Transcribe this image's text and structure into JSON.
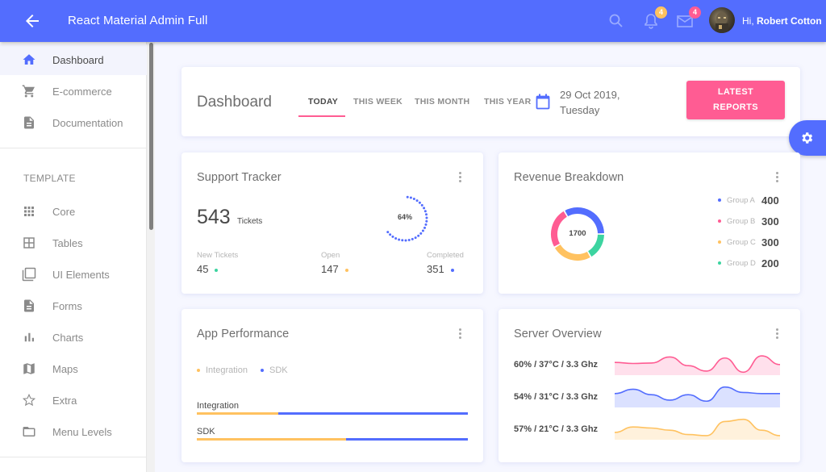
{
  "header": {
    "title": "React Material Admin Full",
    "back_icon": "arrow-left-icon",
    "notifications_count": "4",
    "messages_count": "4",
    "greeting_prefix": "Hi,",
    "user_name": "Robert Cotton",
    "colors": {
      "primary": "#536dfe",
      "warning": "#ffc260",
      "secondary": "#ff5c93"
    }
  },
  "sidebar": {
    "items": [
      {
        "label": "Dashboard",
        "icon": "home-icon",
        "active": true
      },
      {
        "label": "E-commerce",
        "icon": "cart-icon"
      },
      {
        "label": "Documentation",
        "icon": "document-icon"
      }
    ],
    "section_title": "TEMPLATE",
    "template_items": [
      {
        "label": "Core",
        "icon": "grid-icon"
      },
      {
        "label": "Tables",
        "icon": "table-icon"
      },
      {
        "label": "UI Elements",
        "icon": "layers-icon"
      },
      {
        "label": "Forms",
        "icon": "form-icon"
      },
      {
        "label": "Charts",
        "icon": "bar-chart-icon"
      },
      {
        "label": "Maps",
        "icon": "map-icon"
      },
      {
        "label": "Extra",
        "icon": "star-icon"
      },
      {
        "label": "Menu Levels",
        "icon": "folder-icon"
      }
    ]
  },
  "topbar": {
    "page_title": "Dashboard",
    "tabs": [
      {
        "label": "TODAY",
        "active": true
      },
      {
        "label": "THIS WEEK"
      },
      {
        "label": "THIS MONTH"
      },
      {
        "label": "THIS YEAR"
      }
    ],
    "date_line1": "29 Oct 2019,",
    "date_line2": "Tuesday",
    "report_button_line1": "LATEST",
    "report_button_line2": "REPORTS"
  },
  "support": {
    "title": "Support Tracker",
    "total": "543",
    "unit": "Tickets",
    "percent": 64,
    "percent_label": "64%",
    "stats": [
      {
        "label": "New Tickets",
        "value": "45",
        "color": "#3cd4a0"
      },
      {
        "label": "Open",
        "value": "147",
        "color": "#ffc260"
      },
      {
        "label": "Completed",
        "value": "351",
        "color": "#536dfe"
      }
    ]
  },
  "revenue": {
    "title": "Revenue Breakdown",
    "total_label": "1700",
    "groups": [
      {
        "name": "Group A",
        "value": 400,
        "value_label": "400",
        "color": "#536dfe"
      },
      {
        "name": "Group B",
        "value": 300,
        "value_label": "300",
        "color": "#ff5c93"
      },
      {
        "name": "Group C",
        "value": 300,
        "value_label": "300",
        "color": "#ffc260"
      },
      {
        "name": "Group D",
        "value": 200,
        "value_label": "200",
        "color": "#3cd4a0"
      }
    ]
  },
  "performance": {
    "title": "App Performance",
    "legend": [
      {
        "label": "Integration",
        "color": "#ffc260"
      },
      {
        "label": "SDK",
        "color": "#536dfe"
      }
    ],
    "bars": [
      {
        "label": "Integration",
        "progress": 0.3
      },
      {
        "label": "SDK",
        "progress": 0.55
      }
    ]
  },
  "server": {
    "title": "Server Overview",
    "rows": [
      {
        "label": "60% / 37°C / 3.3 Ghz",
        "color": "#ff5c93",
        "fill": "#ffe0ec",
        "values": [
          55,
          50,
          52,
          80,
          40,
          15,
          75,
          10,
          85,
          45
        ]
      },
      {
        "label": "54% / 31°C / 3.3 Ghz",
        "color": "#536dfe",
        "fill": "#dbe1ff",
        "values": [
          60,
          80,
          55,
          30,
          55,
          25,
          90,
          65,
          60,
          60
        ]
      },
      {
        "label": "57% / 21°C / 3.3 Ghz",
        "color": "#ffc260",
        "fill": "#fff1dc",
        "values": [
          30,
          55,
          50,
          40,
          20,
          15,
          80,
          90,
          40,
          15
        ]
      }
    ]
  }
}
